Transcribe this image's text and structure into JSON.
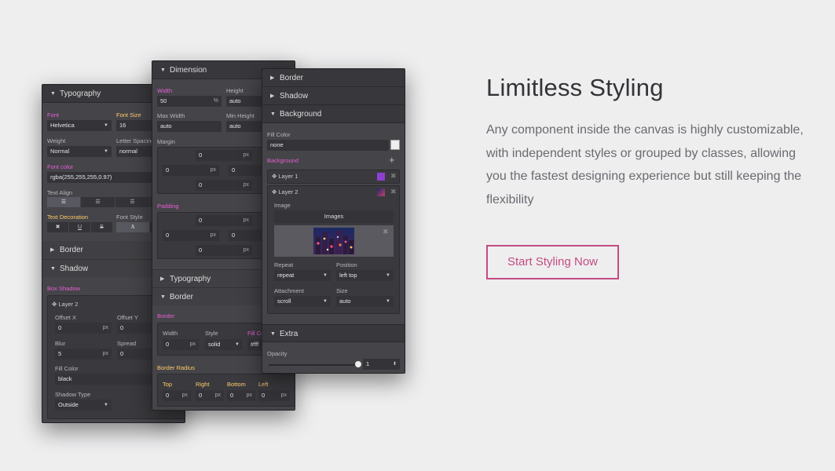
{
  "panel_left": {
    "typography": "Typography",
    "font_label": "Font",
    "font_size_label": "Font Size",
    "font_value": "Helvetica",
    "font_size_value": "16",
    "weight_label": "Weight",
    "letter_spacing_label": "Letter Spacing",
    "weight_value": "Normal",
    "letter_spacing_value": "normal",
    "font_color_label": "Font color",
    "font_color_value": "rgba(255,255,255,0.97)",
    "text_align_label": "Text Align",
    "text_decoration_label": "Text Decoration",
    "font_style_label": "Font Style",
    "deco_none": "✖",
    "deco_underline": "U",
    "deco_strike": "S",
    "font_style_value": "A",
    "border": "Border",
    "shadow": "Shadow",
    "box_shadow_label": "Box Shadow",
    "layer2": "Layer 2",
    "offset_x_label": "Offset X",
    "offset_y_label": "Offset Y",
    "offset_x_value": "0",
    "offset_y_value": "0",
    "unit_px": "px",
    "blur_label": "Blur",
    "spread_label": "Spread",
    "blur_value": "5",
    "spread_value": "0",
    "fill_color_label": "Fill Color",
    "fill_color_value": "black",
    "shadow_type_label": "Shadow Type",
    "shadow_type_value": "Outside"
  },
  "panel_mid": {
    "dimension": "Dimension",
    "width_label": "Width",
    "height_label": "Height",
    "width_value": "50",
    "width_unit": "%",
    "height_value": "auto",
    "max_width_label": "Max Width",
    "min_height_label": "Min Height",
    "max_width_value": "auto",
    "min_height_value": "auto",
    "margin_label": "Margin",
    "margin_top": "0",
    "margin_left": "0",
    "margin_right": "0",
    "margin_bottom": "0",
    "padding_label": "Padding",
    "padding_top": "0",
    "padding_left": "0",
    "padding_right": "0",
    "padding_bottom": "0",
    "unit_px": "px",
    "typography": "Typography",
    "border": "Border",
    "border_label": "Border",
    "b_width_label": "Width",
    "b_style_label": "Style",
    "b_color_label": "Fill Co",
    "b_width_value": "0",
    "b_style_value": "solid",
    "b_color_value": "#fff",
    "border_radius_label": "Border Radius",
    "top_label": "Top",
    "right_label": "Right",
    "bottom_label": "Bottom",
    "left_label": "Left",
    "r_top": "0",
    "r_right": "0",
    "r_bottom": "0",
    "r_left": "0"
  },
  "panel_right": {
    "border": "Border",
    "shadow": "Shadow",
    "background": "Background",
    "fill_color_label": "Fill Color",
    "fill_color_value": "none",
    "background_label": "Background",
    "layer1": "Layer 1",
    "layer2": "Layer 2",
    "image_label": "Image",
    "images_label": "Images",
    "repeat_label": "Repeat",
    "position_label": "Position",
    "repeat_value": "repeat",
    "position_value": "left top",
    "attachment_label": "Attachment",
    "size_label": "Size",
    "attachment_value": "scroll",
    "size_value": "auto",
    "extra": "Extra",
    "opacity_label": "Opacity",
    "opacity_value": "1",
    "layer1_color": "#8e3fd0"
  },
  "hero": {
    "title": "Limitless Styling",
    "description": "Any component inside the canvas is highly customizable, with independent styles or grouped by classes, allowing you the fastest designing experience but still keeping the flexibility",
    "cta": "Start Styling Now"
  }
}
